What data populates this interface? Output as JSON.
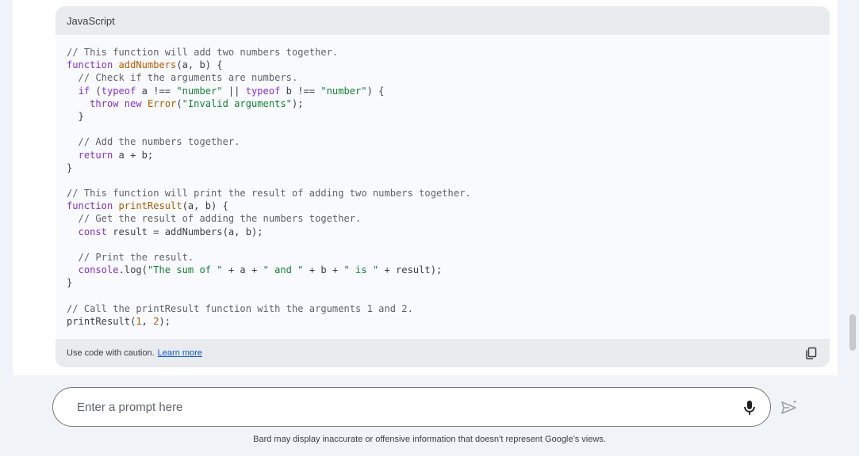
{
  "code_block": {
    "language": "JavaScript",
    "lines": [
      [
        {
          "t": "comment",
          "v": "// This function will add two numbers together."
        }
      ],
      [
        {
          "t": "kw",
          "v": "function "
        },
        {
          "t": "fn",
          "v": "addNumbers"
        },
        {
          "t": "plain",
          "v": "(a, b) {"
        }
      ],
      [
        {
          "t": "comment",
          "v": "  // Check if the arguments are numbers."
        }
      ],
      [
        {
          "t": "plain",
          "v": "  "
        },
        {
          "t": "kw",
          "v": "if"
        },
        {
          "t": "plain",
          "v": " ("
        },
        {
          "t": "kw",
          "v": "typeof"
        },
        {
          "t": "plain",
          "v": " a !== "
        },
        {
          "t": "str",
          "v": "\"number\""
        },
        {
          "t": "plain",
          "v": " || "
        },
        {
          "t": "kw",
          "v": "typeof"
        },
        {
          "t": "plain",
          "v": " b !== "
        },
        {
          "t": "str",
          "v": "\"number\""
        },
        {
          "t": "plain",
          "v": ") {"
        }
      ],
      [
        {
          "t": "plain",
          "v": "    "
        },
        {
          "t": "kw",
          "v": "throw new"
        },
        {
          "t": "plain",
          "v": " "
        },
        {
          "t": "fn",
          "v": "Error"
        },
        {
          "t": "plain",
          "v": "("
        },
        {
          "t": "str",
          "v": "\"Invalid arguments\""
        },
        {
          "t": "plain",
          "v": ");"
        }
      ],
      [
        {
          "t": "plain",
          "v": "  }"
        }
      ],
      [
        {
          "t": "plain",
          "v": ""
        }
      ],
      [
        {
          "t": "comment",
          "v": "  // Add the numbers together."
        }
      ],
      [
        {
          "t": "plain",
          "v": "  "
        },
        {
          "t": "kw",
          "v": "return"
        },
        {
          "t": "plain",
          "v": " a + b;"
        }
      ],
      [
        {
          "t": "plain",
          "v": "}"
        }
      ],
      [
        {
          "t": "plain",
          "v": ""
        }
      ],
      [
        {
          "t": "comment",
          "v": "// This function will print the result of adding two numbers together."
        }
      ],
      [
        {
          "t": "kw",
          "v": "function "
        },
        {
          "t": "fn",
          "v": "printResult"
        },
        {
          "t": "plain",
          "v": "(a, b) {"
        }
      ],
      [
        {
          "t": "comment",
          "v": "  // Get the result of adding the numbers together."
        }
      ],
      [
        {
          "t": "plain",
          "v": "  "
        },
        {
          "t": "kw",
          "v": "const"
        },
        {
          "t": "plain",
          "v": " result = addNumbers(a, b);"
        }
      ],
      [
        {
          "t": "plain",
          "v": ""
        }
      ],
      [
        {
          "t": "comment",
          "v": "  // Print the result."
        }
      ],
      [
        {
          "t": "plain",
          "v": "  "
        },
        {
          "t": "kw",
          "v": "console"
        },
        {
          "t": "plain",
          "v": ".log("
        },
        {
          "t": "str",
          "v": "\"The sum of \""
        },
        {
          "t": "plain",
          "v": " + a + "
        },
        {
          "t": "str",
          "v": "\" and \""
        },
        {
          "t": "plain",
          "v": " + b + "
        },
        {
          "t": "str",
          "v": "\" is \""
        },
        {
          "t": "plain",
          "v": " + result);"
        }
      ],
      [
        {
          "t": "plain",
          "v": "}"
        }
      ],
      [
        {
          "t": "plain",
          "v": ""
        }
      ],
      [
        {
          "t": "comment",
          "v": "// Call the printResult function with the arguments 1 and 2."
        }
      ],
      [
        {
          "t": "plain",
          "v": "printResult("
        },
        {
          "t": "num",
          "v": "1"
        },
        {
          "t": "plain",
          "v": ", "
        },
        {
          "t": "num",
          "v": "2"
        },
        {
          "t": "plain",
          "v": ");"
        }
      ]
    ],
    "footer_text": "Use code with caution.",
    "learn_more_label": "Learn more",
    "copy_icon": "copy-icon"
  },
  "prompt": {
    "placeholder": "Enter a prompt here",
    "value": "",
    "mic_icon": "mic-icon",
    "send_icon": "send-icon"
  },
  "disclaimer": "Bard may display inaccurate or offensive information that doesn’t represent Google’s views.",
  "colors": {
    "page_bg": "#f0f4f9",
    "code_keyword": "#8430ce",
    "code_string": "#188038",
    "code_comment": "#5f6368",
    "code_function": "#b15c00",
    "link": "#0b57d0"
  }
}
